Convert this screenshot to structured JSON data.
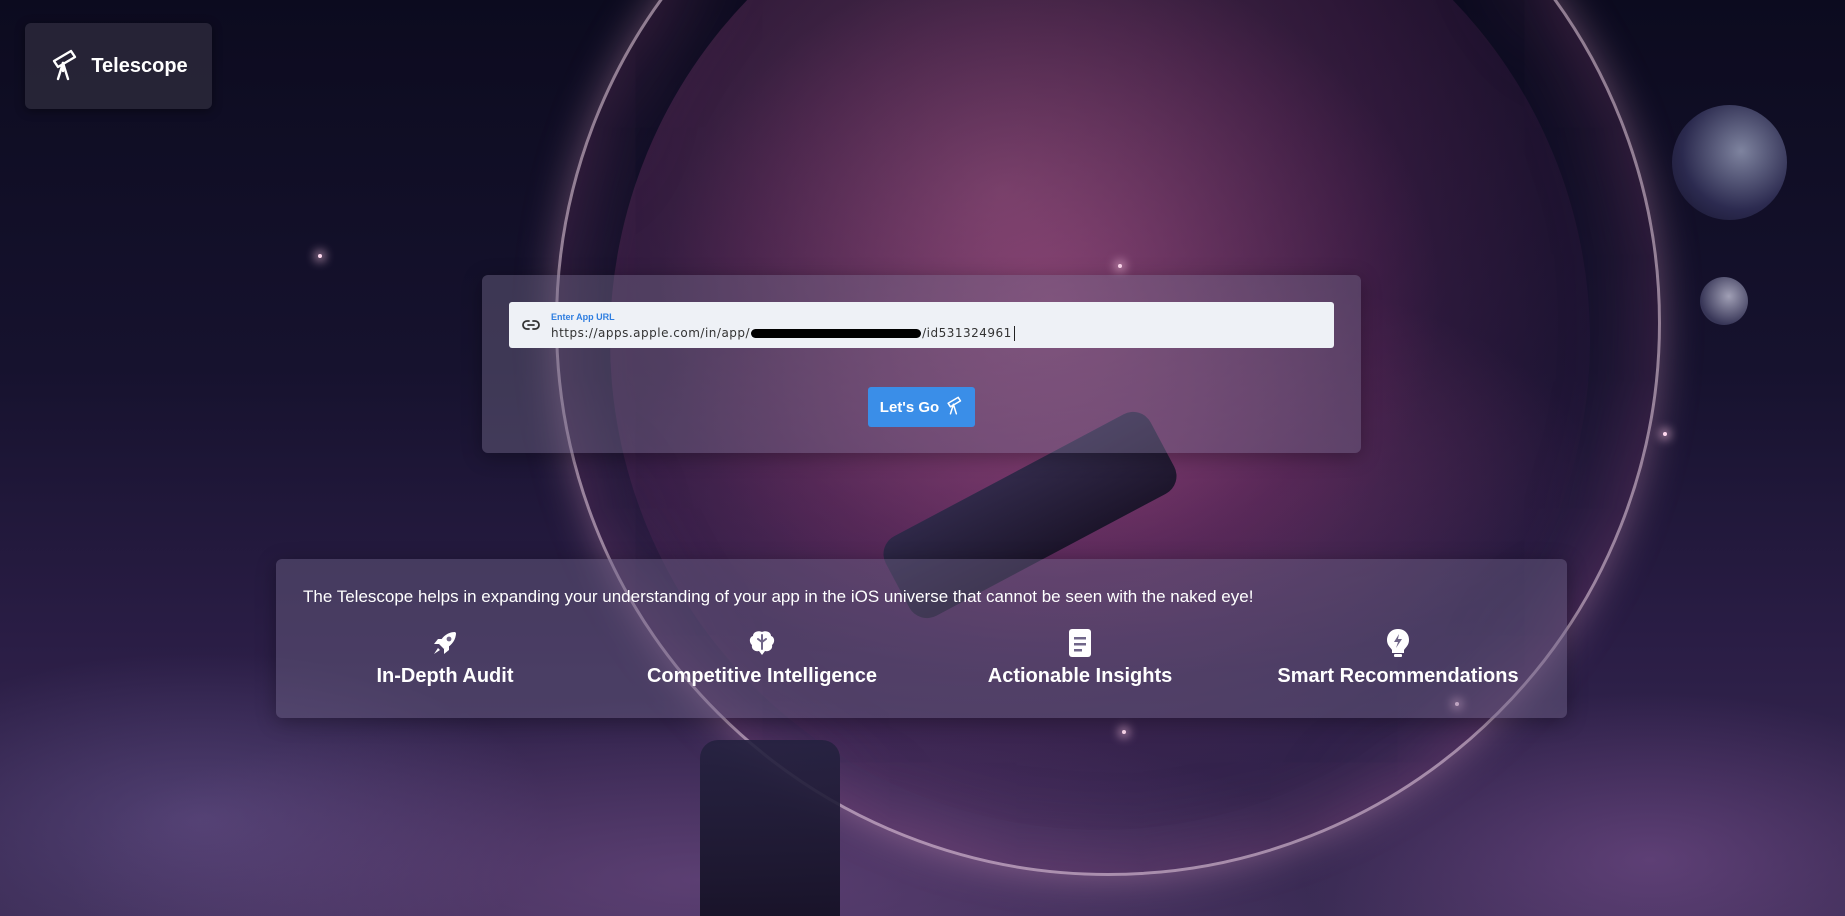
{
  "app": {
    "name": "Telescope",
    "logo_icon": "telescope-icon"
  },
  "search": {
    "label": "Enter App URL",
    "value_prefix": "https://apps.apple.com/in/app/",
    "value_suffix": "/id531324961",
    "link_icon": "link-icon",
    "button_label": "Let's Go",
    "button_icon": "telescope-icon",
    "accent_color": "#3a8ee8"
  },
  "features": {
    "tagline": "The Telescope helps in expanding your understanding of your app in the iOS universe that cannot be seen with the naked eye!",
    "items": [
      {
        "icon": "rocket-icon",
        "title": "In-Depth Audit"
      },
      {
        "icon": "brain-icon",
        "title": "Competitive Intelligence"
      },
      {
        "icon": "document-icon",
        "title": "Actionable Insights"
      },
      {
        "icon": "lightbulb-icon",
        "title": "Smart Recommendations"
      }
    ]
  }
}
